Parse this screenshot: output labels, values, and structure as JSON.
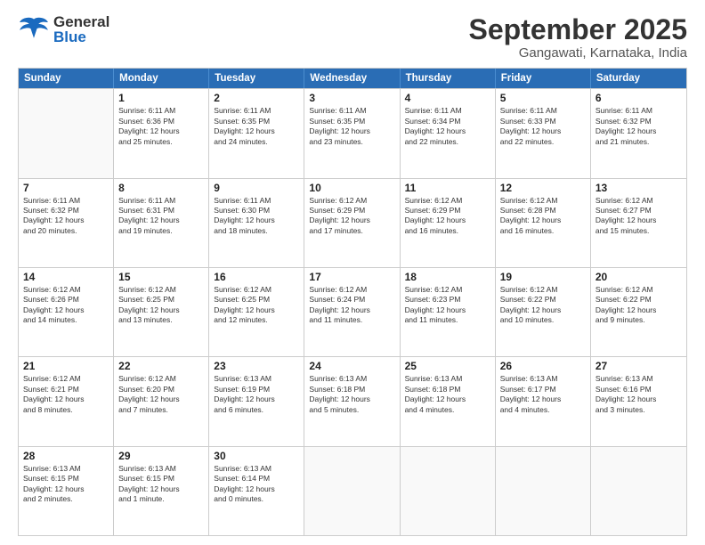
{
  "header": {
    "logo": {
      "general": "General",
      "blue": "Blue"
    },
    "title": "September 2025",
    "location": "Gangawati, Karnataka, India"
  },
  "calendar": {
    "days": [
      "Sunday",
      "Monday",
      "Tuesday",
      "Wednesday",
      "Thursday",
      "Friday",
      "Saturday"
    ],
    "weeks": [
      [
        {
          "day": null,
          "info": null
        },
        {
          "day": "1",
          "info": "Sunrise: 6:11 AM\nSunset: 6:36 PM\nDaylight: 12 hours\nand 25 minutes."
        },
        {
          "day": "2",
          "info": "Sunrise: 6:11 AM\nSunset: 6:35 PM\nDaylight: 12 hours\nand 24 minutes."
        },
        {
          "day": "3",
          "info": "Sunrise: 6:11 AM\nSunset: 6:35 PM\nDaylight: 12 hours\nand 23 minutes."
        },
        {
          "day": "4",
          "info": "Sunrise: 6:11 AM\nSunset: 6:34 PM\nDaylight: 12 hours\nand 22 minutes."
        },
        {
          "day": "5",
          "info": "Sunrise: 6:11 AM\nSunset: 6:33 PM\nDaylight: 12 hours\nand 22 minutes."
        },
        {
          "day": "6",
          "info": "Sunrise: 6:11 AM\nSunset: 6:32 PM\nDaylight: 12 hours\nand 21 minutes."
        }
      ],
      [
        {
          "day": "7",
          "info": "Sunrise: 6:11 AM\nSunset: 6:32 PM\nDaylight: 12 hours\nand 20 minutes."
        },
        {
          "day": "8",
          "info": "Sunrise: 6:11 AM\nSunset: 6:31 PM\nDaylight: 12 hours\nand 19 minutes."
        },
        {
          "day": "9",
          "info": "Sunrise: 6:11 AM\nSunset: 6:30 PM\nDaylight: 12 hours\nand 18 minutes."
        },
        {
          "day": "10",
          "info": "Sunrise: 6:12 AM\nSunset: 6:29 PM\nDaylight: 12 hours\nand 17 minutes."
        },
        {
          "day": "11",
          "info": "Sunrise: 6:12 AM\nSunset: 6:29 PM\nDaylight: 12 hours\nand 16 minutes."
        },
        {
          "day": "12",
          "info": "Sunrise: 6:12 AM\nSunset: 6:28 PM\nDaylight: 12 hours\nand 16 minutes."
        },
        {
          "day": "13",
          "info": "Sunrise: 6:12 AM\nSunset: 6:27 PM\nDaylight: 12 hours\nand 15 minutes."
        }
      ],
      [
        {
          "day": "14",
          "info": "Sunrise: 6:12 AM\nSunset: 6:26 PM\nDaylight: 12 hours\nand 14 minutes."
        },
        {
          "day": "15",
          "info": "Sunrise: 6:12 AM\nSunset: 6:25 PM\nDaylight: 12 hours\nand 13 minutes."
        },
        {
          "day": "16",
          "info": "Sunrise: 6:12 AM\nSunset: 6:25 PM\nDaylight: 12 hours\nand 12 minutes."
        },
        {
          "day": "17",
          "info": "Sunrise: 6:12 AM\nSunset: 6:24 PM\nDaylight: 12 hours\nand 11 minutes."
        },
        {
          "day": "18",
          "info": "Sunrise: 6:12 AM\nSunset: 6:23 PM\nDaylight: 12 hours\nand 11 minutes."
        },
        {
          "day": "19",
          "info": "Sunrise: 6:12 AM\nSunset: 6:22 PM\nDaylight: 12 hours\nand 10 minutes."
        },
        {
          "day": "20",
          "info": "Sunrise: 6:12 AM\nSunset: 6:22 PM\nDaylight: 12 hours\nand 9 minutes."
        }
      ],
      [
        {
          "day": "21",
          "info": "Sunrise: 6:12 AM\nSunset: 6:21 PM\nDaylight: 12 hours\nand 8 minutes."
        },
        {
          "day": "22",
          "info": "Sunrise: 6:12 AM\nSunset: 6:20 PM\nDaylight: 12 hours\nand 7 minutes."
        },
        {
          "day": "23",
          "info": "Sunrise: 6:13 AM\nSunset: 6:19 PM\nDaylight: 12 hours\nand 6 minutes."
        },
        {
          "day": "24",
          "info": "Sunrise: 6:13 AM\nSunset: 6:18 PM\nDaylight: 12 hours\nand 5 minutes."
        },
        {
          "day": "25",
          "info": "Sunrise: 6:13 AM\nSunset: 6:18 PM\nDaylight: 12 hours\nand 4 minutes."
        },
        {
          "day": "26",
          "info": "Sunrise: 6:13 AM\nSunset: 6:17 PM\nDaylight: 12 hours\nand 4 minutes."
        },
        {
          "day": "27",
          "info": "Sunrise: 6:13 AM\nSunset: 6:16 PM\nDaylight: 12 hours\nand 3 minutes."
        }
      ],
      [
        {
          "day": "28",
          "info": "Sunrise: 6:13 AM\nSunset: 6:15 PM\nDaylight: 12 hours\nand 2 minutes."
        },
        {
          "day": "29",
          "info": "Sunrise: 6:13 AM\nSunset: 6:15 PM\nDaylight: 12 hours\nand 1 minute."
        },
        {
          "day": "30",
          "info": "Sunrise: 6:13 AM\nSunset: 6:14 PM\nDaylight: 12 hours\nand 0 minutes."
        },
        {
          "day": null,
          "info": null
        },
        {
          "day": null,
          "info": null
        },
        {
          "day": null,
          "info": null
        },
        {
          "day": null,
          "info": null
        }
      ]
    ]
  }
}
